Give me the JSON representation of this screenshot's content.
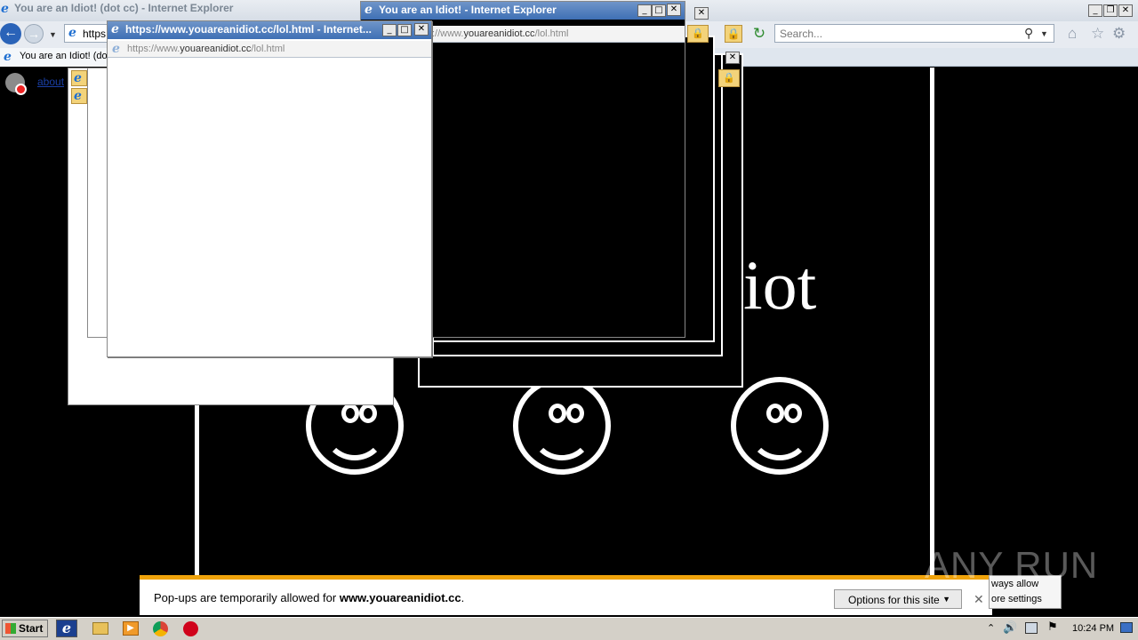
{
  "main_window": {
    "title": "You are an Idiot! (dot cc) - Internet Explorer",
    "address_partial": "https",
    "search_placeholder": "Search...",
    "tab_title": "You are an Idiot! (dot cc)",
    "blocked_link": "about"
  },
  "page": {
    "heading_fragment": "iot"
  },
  "popup_front": {
    "title": "https://www.youareanidiot.cc/lol.html - Internet...",
    "url_dim_prefix": "https://www.",
    "url_domain": "youareanidiot.cc",
    "url_path": "/lol.html"
  },
  "popup_black": {
    "title": "You are an Idiot! - Internet Explorer",
    "url_dim_prefix": "://www.",
    "url_domain": "youareanidiot.cc",
    "url_path": "/lol.html"
  },
  "notification": {
    "text_prefix": "Pop-ups are temporarily allowed for ",
    "text_domain": "www.youareanidiot.cc",
    "text_suffix": ".",
    "options_label": "Options for this site",
    "menu_items": [
      "ways allow",
      "ore settings"
    ]
  },
  "taskbar": {
    "start_label": "Start",
    "clock": "10:24 PM"
  },
  "watermark": "ANY RUN",
  "colors": {
    "ie_blue": "#1f6fd1",
    "notification_accent": "#f0a30a",
    "taskbar": "#d4d0c8"
  }
}
